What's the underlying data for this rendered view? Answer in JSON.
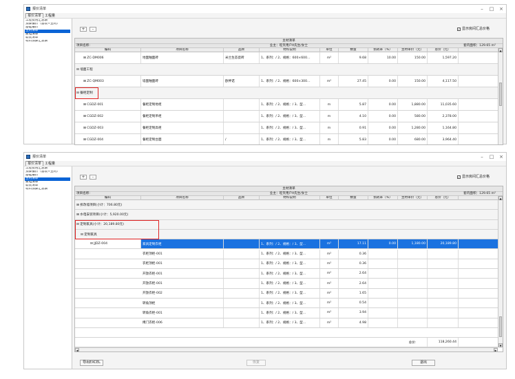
{
  "window": {
    "title": "报价清单",
    "minimize": "–",
    "maximize": "□",
    "close": "×"
  },
  "menu": {
    "items": [
      "报价清单",
      "工程量"
    ]
  },
  "sidebar": {
    "items": [
      "工程费用汇总表",
      "预算报价（基装+主材）",
      "基础报价",
      "主材清单",
      "家电清单",
      "软装清单",
      "材料预算汇总表"
    ],
    "selected_index": 3
  },
  "toolbar": {
    "expand_label": "+",
    "collapse_label": "-",
    "show_room_summary_label": "显示房间汇总价格",
    "show_room_summary_checked": true
  },
  "sheet": {
    "title": "主材清单",
    "project_label": "项目名称:",
    "owner_label": "业主：旺笑用户X先生/女士",
    "area_label": "套内面积：129.65 m²"
  },
  "columns": [
    "编码",
    "项目名称",
    "品牌",
    "材料说明",
    "单位",
    "数量",
    "损耗率（%）",
    "主材单价（元）",
    "总价（元）"
  ],
  "top_table": {
    "rows": [
      {
        "kind": "item",
        "code": "⊞ ZC-DM006",
        "name": "地面釉面砖",
        "brand": "米兰生态瓷砖",
        "spec": "1、系列：/ 2、规格：600×600…",
        "unit": "m²",
        "qty": "9.68",
        "loss": "10.00",
        "price": "150.00",
        "total": "1,597.20"
      },
      {
        "kind": "group",
        "label": "⊟ 墙面工程"
      },
      {
        "kind": "item",
        "code": "⊞ ZC-QM003",
        "name": "墙面釉面砖",
        "brand": "欧神诺",
        "spec": "1、系列：/ 2、规格：600×300…",
        "unit": "m²",
        "qty": "27.45",
        "loss": "0.00",
        "price": "150.00",
        "total": "4,117.50"
      },
      {
        "kind": "group",
        "label": "⊟ 餐柜定制",
        "highlight": true
      },
      {
        "kind": "item",
        "code": "⊞ CGDZ-001",
        "name": "餐柜定制地柜",
        "brand": "",
        "spec": "1、系列：/ 2、规格：/ 3、型…",
        "unit": "m",
        "qty": "5.87",
        "loss": "0.00",
        "price": "1,880.00",
        "total": "11,035.60"
      },
      {
        "kind": "item",
        "code": "⊞ CGDZ-002",
        "name": "餐柜定制吊柜",
        "brand": "",
        "spec": "1、系列：/ 2、规格：/ 3、型…",
        "unit": "m",
        "qty": "4.10",
        "loss": "0.00",
        "price": "580.00",
        "total": "2,378.00"
      },
      {
        "kind": "item",
        "code": "⊞ CGDZ-003",
        "name": "餐柜定制高柜",
        "brand": "",
        "spec": "1、系列：/ 2、规格：/ 3、型…",
        "unit": "m",
        "qty": "0.91",
        "loss": "0.00",
        "price": "1,280.00",
        "total": "1,164.80"
      },
      {
        "kind": "item",
        "code": "⊞ CGDZ-004",
        "name": "餐柜定制台面",
        "brand": "/",
        "spec": "1、系列：/ 2、规格：/ 3、型…",
        "unit": "m",
        "qty": "5.83",
        "loss": "0.00",
        "price": "680.00",
        "total": "3,964.40"
      }
    ]
  },
  "bottom_table": {
    "rows": [
      {
        "kind": "group",
        "label": "⊞ 拆改墙项目(小计：706.80元)"
      },
      {
        "kind": "group",
        "label": "⊞ 水电安装项目(小计：5,920.00元)"
      },
      {
        "kind": "group",
        "label": "⊟ 定制家具(小计：20,189.80元)",
        "highlight": true
      },
      {
        "kind": "group",
        "label": "⊟ 定制家具",
        "indent": true,
        "highlight": true
      },
      {
        "kind": "item",
        "selected": true,
        "code": "⊟ JJDZ-004",
        "name": "家具定制衣柜",
        "brand": "",
        "spec": "1、系列：/ 2、规格：/ 3、型…",
        "unit": "m²",
        "qty": "17.11",
        "loss": "0.00",
        "price": "1,180.00",
        "total": "20,189.80"
      },
      {
        "kind": "sub",
        "name": "衣柜顶柜-001",
        "spec": "1、系列：/ 2、规格：/ 3、型…",
        "unit": "m²",
        "qty": "0.36"
      },
      {
        "kind": "sub",
        "name": "衣柜顶柜-001",
        "spec": "1、系列：/ 2、规格：/ 3、型…",
        "unit": "m²",
        "qty": "0.36"
      },
      {
        "kind": "sub",
        "name": "开放衣柜-001",
        "spec": "1、系列：/ 2、规格：/ 3、型…",
        "unit": "m²",
        "qty": "2.64"
      },
      {
        "kind": "sub",
        "name": "开放衣柜-001",
        "spec": "1、系列：/ 2、规格：/ 3、型…",
        "unit": "m²",
        "qty": "2.64"
      },
      {
        "kind": "sub",
        "name": "开放衣柜-002",
        "spec": "1、系列：/ 2、规格：/ 3、型…",
        "unit": "m²",
        "qty": "1.65"
      },
      {
        "kind": "sub",
        "name": "转角顶柜",
        "spec": "1、系列：/ 2、规格：/ 3、型…",
        "unit": "m²",
        "qty": "0.54"
      },
      {
        "kind": "sub",
        "name": "转角衣柜-001",
        "spec": "1、系列：/ 2、规格：/ 3、型…",
        "unit": "m²",
        "qty": "3.94"
      },
      {
        "kind": "sub",
        "name": "掩门衣柜-006",
        "spec": "1、系列：/ 2、规格：/ 3、型…",
        "unit": "m²",
        "qty": "4.98"
      },
      {
        "kind": "blank"
      }
    ],
    "total_label": "总价:",
    "total_value": "118,260.44"
  },
  "buttons": {
    "export": "导出EXCEL",
    "restore": "恢复",
    "exit": "退出"
  }
}
